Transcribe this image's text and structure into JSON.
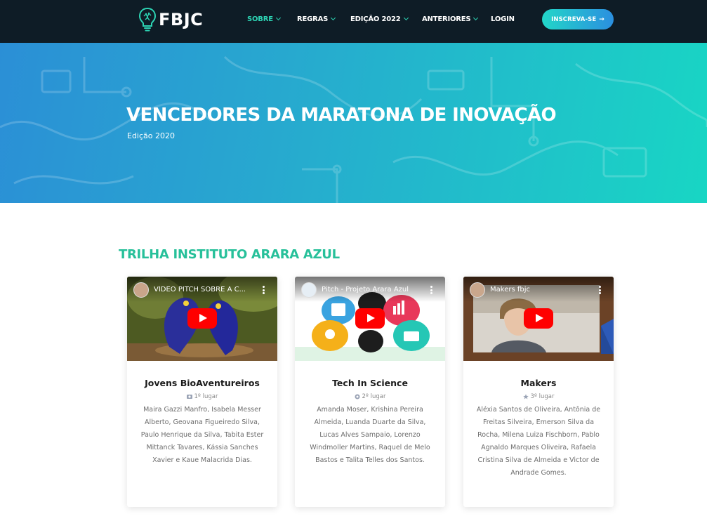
{
  "nav": {
    "logo_text": "FBJC",
    "items": [
      {
        "label": "SOBRE",
        "active": true,
        "dropdown": true
      },
      {
        "label": "REGRAS",
        "active": false,
        "dropdown": true
      },
      {
        "label": "EDIÇÃO 2022",
        "active": false,
        "dropdown": true
      },
      {
        "label": "ANTERIORES",
        "active": false,
        "dropdown": true
      },
      {
        "label": "LOGIN",
        "active": false,
        "dropdown": false
      }
    ],
    "cta_label": "INSCREVA-SE",
    "cta_icon": "arrow-right-icon"
  },
  "hero": {
    "title": "VENCEDORES DA MARATONA DE INOVAÇÃO",
    "subtitle": "Edição 2020"
  },
  "section": {
    "title": "TRILHA INSTITUTO ARARA AZUL"
  },
  "cards": [
    {
      "video_title": "VÍDEO PITCH SOBRE A C...",
      "name": "Jovens BioAventureiros",
      "place": "1º lugar",
      "place_icon": "medal-icon",
      "members": "Maira Gazzi Manfro, Isabela Messer Alberto, Geovana Figueiredo Silva, Paulo Henrique da Silva, Tabita Ester Mittanck Tavares, Kássia Sanches Xavier e Kaue Malacrida Dias."
    },
    {
      "video_title": "Pitch - Projeto Arara Azul",
      "name": "Tech In Science",
      "place": "2º lugar",
      "place_icon": "award-icon",
      "members": "Amanda Moser, Krishina Pereira Almeida, Luanda Duarte da Silva, Lucas Alves Sampaio, Lorenzo Windmoller Martins, Raquel de Melo Bastos e Talita Telles dos Santos."
    },
    {
      "video_title": "Makers fbjc",
      "name": "Makers",
      "place": "3º lugar",
      "place_icon": "star-icon",
      "members": "Aléxia Santos de Oliveira, Antônia de Freitas Silveira, Emerson Silva da Rocha, Milena Luiza Fischborn, Pablo Agnaldo Marques Oliveira, Rafaela Cristina Silva de Almeida e Victor de Andrade Gomes."
    }
  ],
  "colors": {
    "nav_bg": "#0e1c26",
    "accent": "#2dd4b4",
    "section_title": "#27c09a",
    "hero_start": "#2b8fd6",
    "hero_end": "#18d6c4",
    "youtube_red": "#ff0000"
  }
}
